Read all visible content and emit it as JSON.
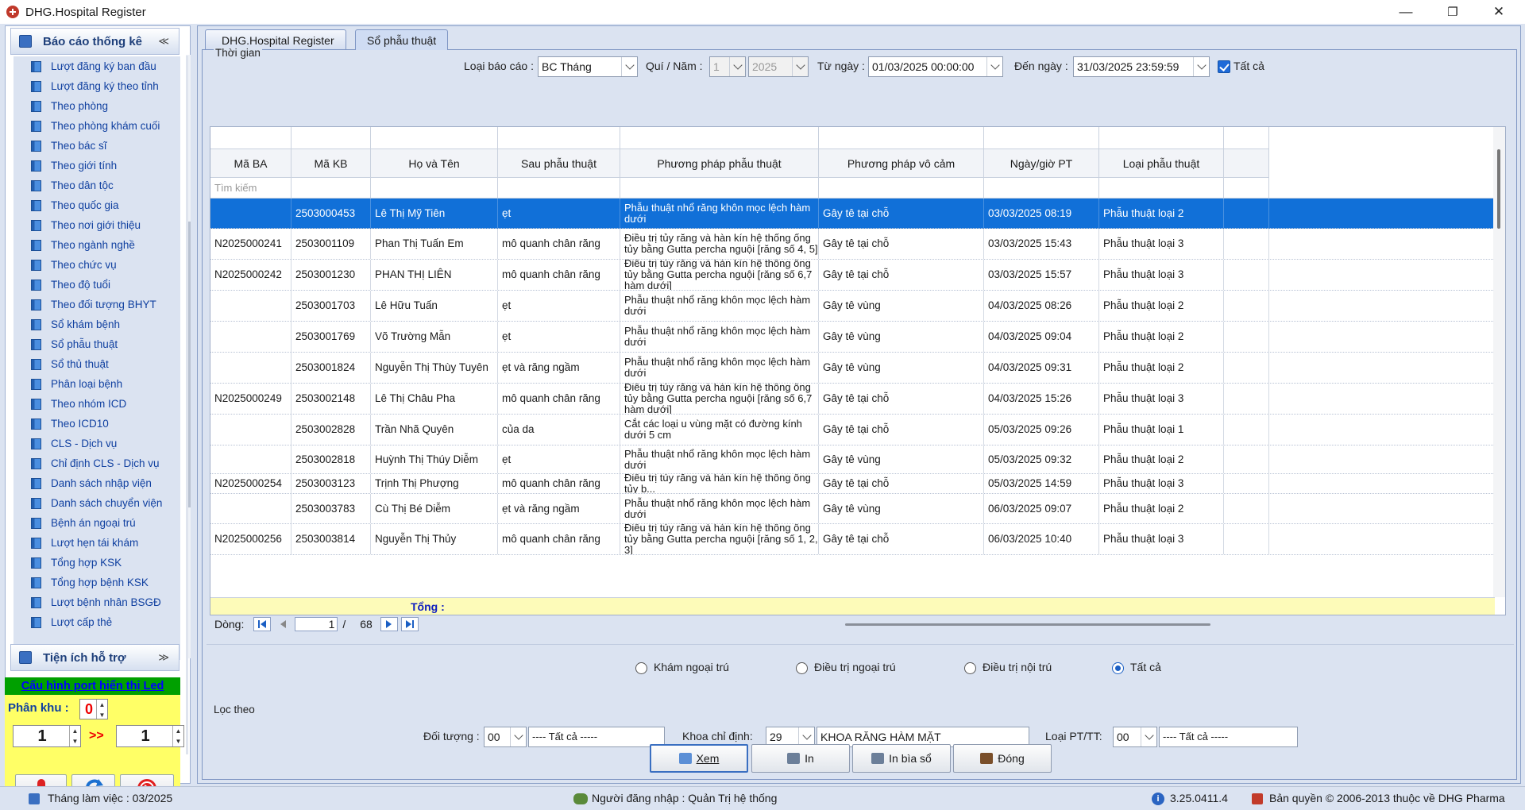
{
  "window": {
    "title": "DHG.Hospital Register",
    "minimize": "—",
    "restore": "❐",
    "close": "✕"
  },
  "sidebar": {
    "group1": {
      "label": "Báo cáo thống kê",
      "chevron": "≪"
    },
    "items": [
      "Lượt đăng ký ban đầu",
      "Lượt đăng ký theo tỉnh",
      "Theo phòng",
      "Theo phòng khám cuối",
      "Theo bác sĩ",
      "Theo giới tính",
      "Theo dân tộc",
      "Theo quốc gia",
      "Theo nơi giới thiệu",
      "Theo ngành nghề",
      "Theo chức vụ",
      "Theo độ tuổi",
      "Theo đối tượng BHYT",
      "Sổ khám bệnh",
      "Sổ phẫu thuật",
      "Sổ thủ thuật",
      "Phân loại bệnh",
      "Theo nhóm ICD",
      "Theo ICD10",
      "CLS - Dịch vụ",
      "Chỉ định CLS - Dịch vụ",
      "Danh sách nhập viện",
      "Danh sách chuyển viện",
      "Bệnh án ngoại trú",
      "Lượt hẹn tái khám",
      "Tổng hợp KSK",
      "Tổng hợp bệnh KSK",
      "Lượt bệnh nhân BSGĐ",
      "Lượt cấp thẻ"
    ],
    "group2": {
      "label": "Tiện ích hỗ trợ",
      "chevron": "≫"
    }
  },
  "tools": {
    "config_link": "Cấu hình port hiển thị Led",
    "phan_khu_label": "Phân khu :",
    "phan_khu_value": "0",
    "from_value": "1",
    "arrow": ">>",
    "to_value": "1"
  },
  "tabs": [
    "DHG.Hospital Register",
    "Sổ phẫu thuật"
  ],
  "time_section": {
    "label": "Thời gian",
    "report_type_label": "Loại báo cáo :",
    "report_type": "BC Tháng",
    "quarter_label": "Quí / Năm :",
    "quarter": "1",
    "year": "2025",
    "from_label": "Từ ngày :",
    "from_date": "01/03/2025 00:00:00",
    "to_label": "Đến ngày :",
    "to_date": "31/03/2025 23:59:59",
    "all_label": "Tất cả"
  },
  "grid": {
    "columns": [
      "Mã BA",
      "Mã KB",
      "Họ và Tên",
      "Sau phẫu thuật",
      "Phương pháp phẫu thuật",
      "Phương pháp vô cảm",
      "Ngày/giờ PT",
      "Loại phẫu thuật"
    ],
    "search_placeholder": "Tìm kiếm",
    "rows": [
      [
        "",
        "2503000453",
        "Lê Thị Mỹ Tiên",
        "ẹt",
        "Phẫu thuật nhổ răng khôn mọc lệch hàm dưới",
        "Gây tê tại chỗ",
        "03/03/2025 08:19",
        "Phẫu thuật loại 2"
      ],
      [
        "N2025000241",
        "2503001109",
        "Phan Thị Tuấn Em",
        "mô quanh chân răng",
        "Điều trị tủy răng và hàn kín hệ thống ống tủy bằng Gutta percha nguội [răng số  4, 5]",
        "Gây tê tại chỗ",
        "03/03/2025 15:43",
        "Phẫu thuật loại 3"
      ],
      [
        "N2025000242",
        "2503001230",
        "PHAN THỊ LIÊN",
        "mô quanh chân răng",
        "Điều trị tủy răng và hàn kín hệ thống ống tủy bằng Gutta percha nguội [răng số  6,7 hàm dưới]",
        "Gây tê tại chỗ",
        "03/03/2025 15:57",
        "Phẫu thuật loại 3"
      ],
      [
        "",
        "2503001703",
        "Lê Hữu Tuấn",
        "ẹt",
        "Phẫu thuật nhổ răng khôn mọc lệch hàm dưới",
        "Gây tê vùng",
        "04/03/2025 08:26",
        "Phẫu thuật loại 2"
      ],
      [
        "",
        "2503001769",
        "Võ Trường Mẫn",
        "ẹt",
        "Phẫu thuật nhổ răng khôn mọc lệch hàm dưới",
        "Gây tê vùng",
        "04/03/2025 09:04",
        "Phẫu thuật loại 2"
      ],
      [
        "",
        "2503001824",
        "Nguyễn Thị Thùy Tuyên",
        "ẹt và răng ngầm",
        "Phẫu thuật nhổ răng khôn mọc lệch hàm dưới",
        "Gây tê vùng",
        "04/03/2025 09:31",
        "Phẫu thuật loại 2"
      ],
      [
        "N2025000249",
        "2503002148",
        "Lê Thị Châu Pha",
        "mô quanh chân răng",
        "Điều trị tủy răng và hàn kín hệ thống ống tủy bằng Gutta percha nguội [răng số  6,7 hàm dưới]",
        "Gây tê tại chỗ",
        "04/03/2025 15:26",
        "Phẫu thuật loại 3"
      ],
      [
        "",
        "2503002828",
        "Trần Nhã Quyên",
        " của da",
        "Cắt các loại u vùng mặt có đường kính dưới 5 cm",
        "Gây tê tại chỗ",
        "05/03/2025 09:26",
        "Phẫu thuật loại 1"
      ],
      [
        "",
        "2503002818",
        "Huỳnh Thị Thúy Diễm",
        "ẹt",
        "Phẫu thuật nhổ răng khôn mọc lệch hàm dưới",
        "Gây tê vùng",
        "05/03/2025 09:32",
        "Phẫu thuật loại 2"
      ],
      [
        "N2025000254",
        "2503003123",
        "Trịnh Thị Phượng",
        "mô quanh chân răng",
        "Điều trị tủy răng và hàn kín hệ thống ống tủy b...",
        "Gây tê tại chỗ",
        "05/03/2025 14:59",
        "Phẫu thuật loại 3"
      ],
      [
        "",
        "2503003783",
        "Cù Thị Bé Diễm",
        "ẹt và răng ngầm",
        "Phẫu thuật nhổ răng khôn mọc lệch hàm dưới",
        "Gây tê vùng",
        "06/03/2025 09:07",
        "Phẫu thuật loại 2"
      ],
      [
        "N2025000256",
        "2503003814",
        "Nguyễn Thị Thủy",
        "mô quanh chân răng",
        "Điều trị tủy răng và hàn kín hệ thống ống tủy bằng Gutta percha nguội [răng số 1, 2, 3]",
        "Gây tê tại chỗ",
        "06/03/2025 10:40",
        "Phẫu thuật loại 3"
      ]
    ],
    "total_label": "Tổng :"
  },
  "pager": {
    "label": "Dòng:",
    "current": "1",
    "separator": "/",
    "total": "68"
  },
  "filters": {
    "radios": [
      "Khám ngoại trú",
      "Điều trị ngoại trú",
      "Điều trị nội trú",
      "Tất cả"
    ],
    "section_label": "Lọc theo",
    "subject_label": "Đối tượng :",
    "subject_code": "00",
    "subject_name": "---- Tất cả -----",
    "dept_label": "Khoa chỉ định:",
    "dept_code": "29",
    "dept_name": "KHOA RĂNG HÀM MẶT",
    "type_label": "Loại PT/TT:",
    "type_code": "00",
    "type_name": "---- Tất cả -----"
  },
  "buttons": {
    "view": "Xem",
    "print": "In",
    "print_cover": "In bìa sổ",
    "close": "Đóng"
  },
  "status": {
    "month": "Tháng làm việc : 03/2025",
    "user": "Người đăng nhập : Quản Trị hệ thống",
    "version": "3.25.0411.4",
    "copyright": "Bản quyền © 2006-2013 thuộc về DHG Pharma"
  }
}
